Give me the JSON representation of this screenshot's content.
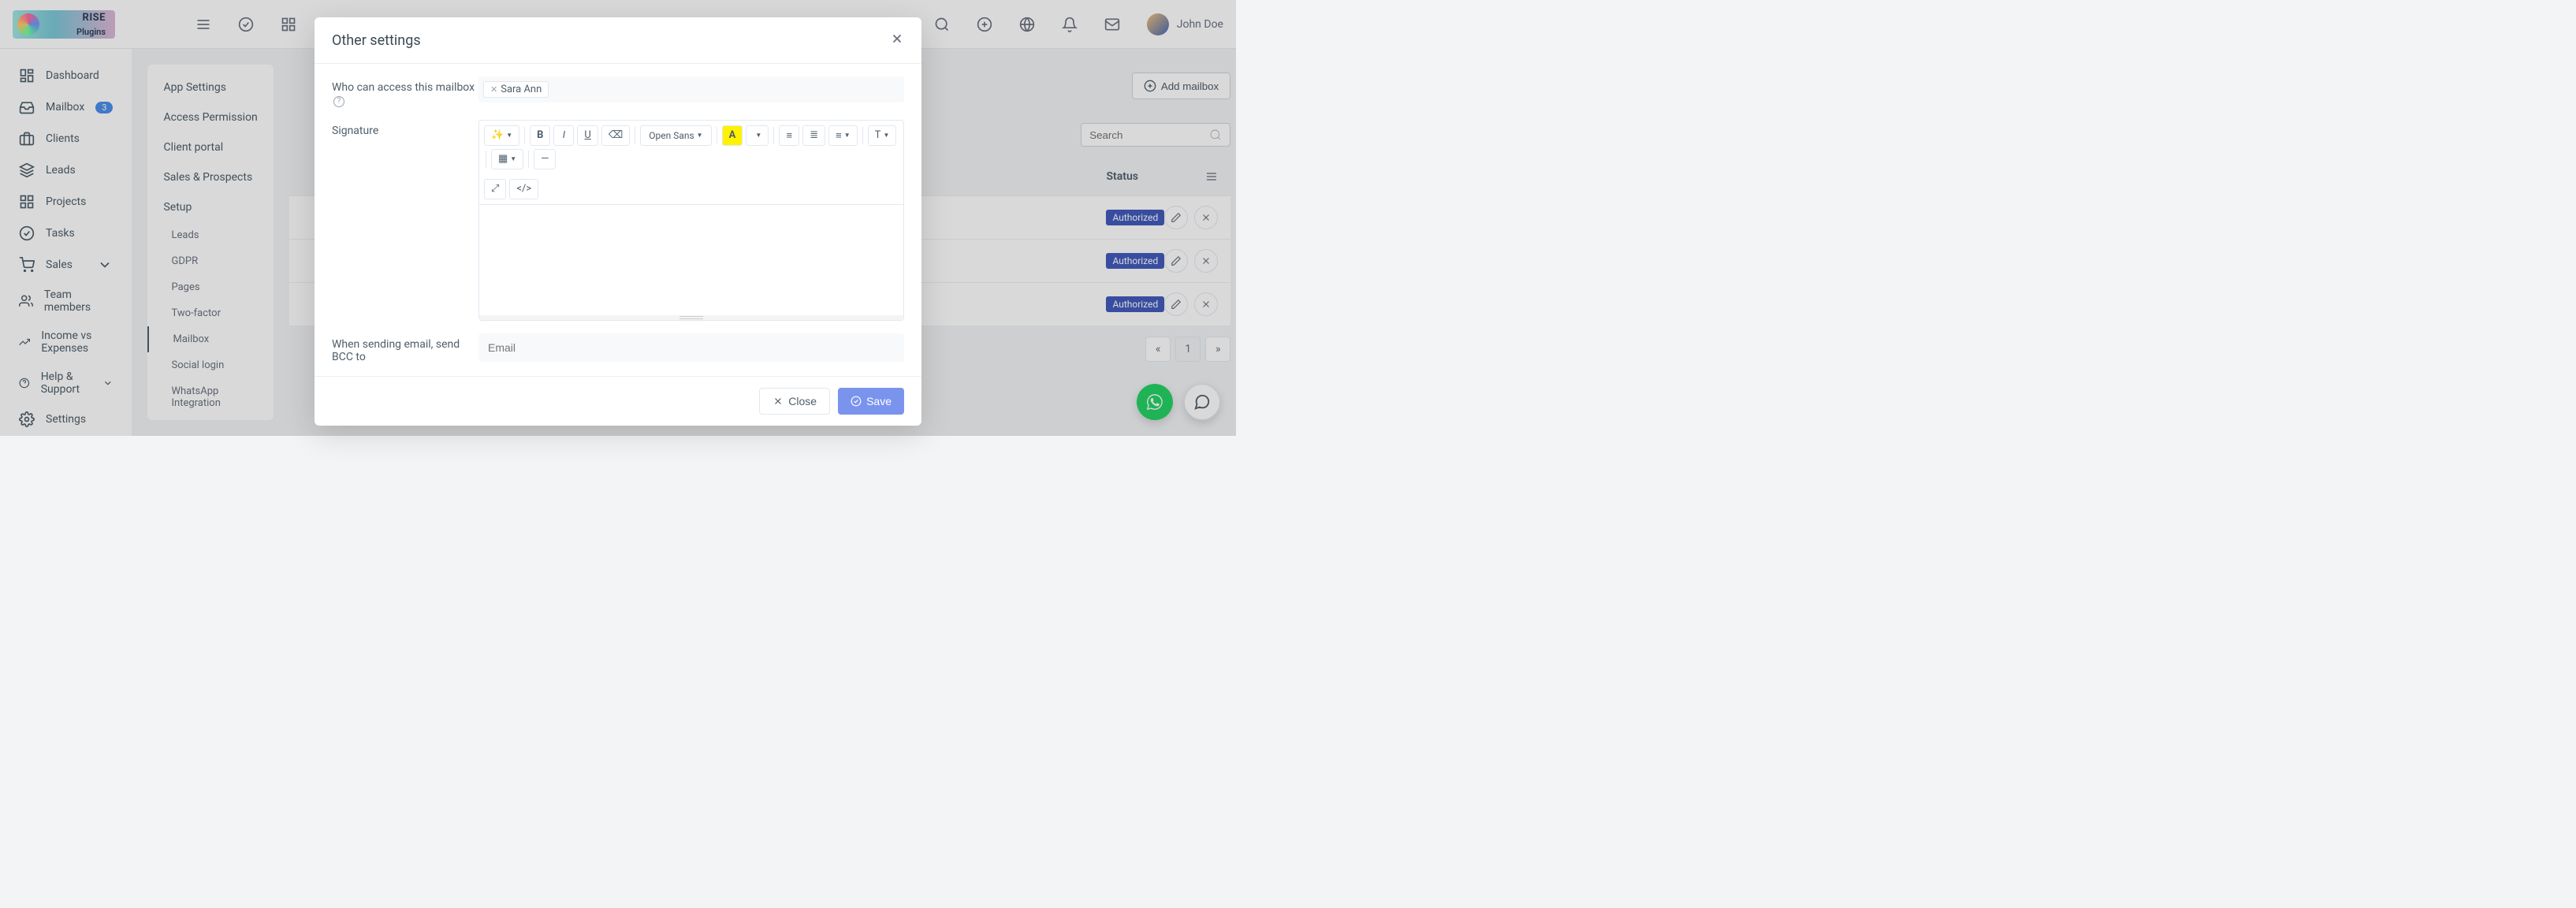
{
  "logo": {
    "line1": "RISE",
    "line2": "Plugins"
  },
  "user": {
    "name": "John Doe"
  },
  "sidebar": {
    "items": [
      {
        "label": "Dashboard"
      },
      {
        "label": "Mailbox",
        "badge": "3"
      },
      {
        "label": "Clients"
      },
      {
        "label": "Leads"
      },
      {
        "label": "Projects"
      },
      {
        "label": "Tasks"
      },
      {
        "label": "Sales"
      },
      {
        "label": "Team members"
      },
      {
        "label": "Income vs Expenses"
      },
      {
        "label": "Help & Support"
      },
      {
        "label": "Settings"
      }
    ]
  },
  "settings_panel": {
    "top": [
      "App Settings",
      "Access Permission",
      "Client portal",
      "Sales & Prospects",
      "Setup"
    ],
    "sub": [
      "Leads",
      "GDPR",
      "Pages",
      "Two-factor",
      "Mailbox",
      "Social login",
      "WhatsApp Integration"
    ]
  },
  "content": {
    "add_button": "Add mailbox",
    "search_placeholder": "Search",
    "columns": {
      "status": "Status"
    },
    "rows": [
      {
        "status": "Authorized"
      },
      {
        "status": "Authorized"
      },
      {
        "status": "Authorized"
      }
    ],
    "pagination": {
      "current": "1"
    }
  },
  "modal": {
    "title": "Other settings",
    "access_label": "Who can access this mailbox",
    "access_tag": "Sara Ann",
    "signature_label": "Signature",
    "font_name": "Open Sans",
    "bcc_label": "When sending email, send BCC to",
    "bcc_placeholder": "Email",
    "close_btn": "Close",
    "save_btn": "Save"
  }
}
